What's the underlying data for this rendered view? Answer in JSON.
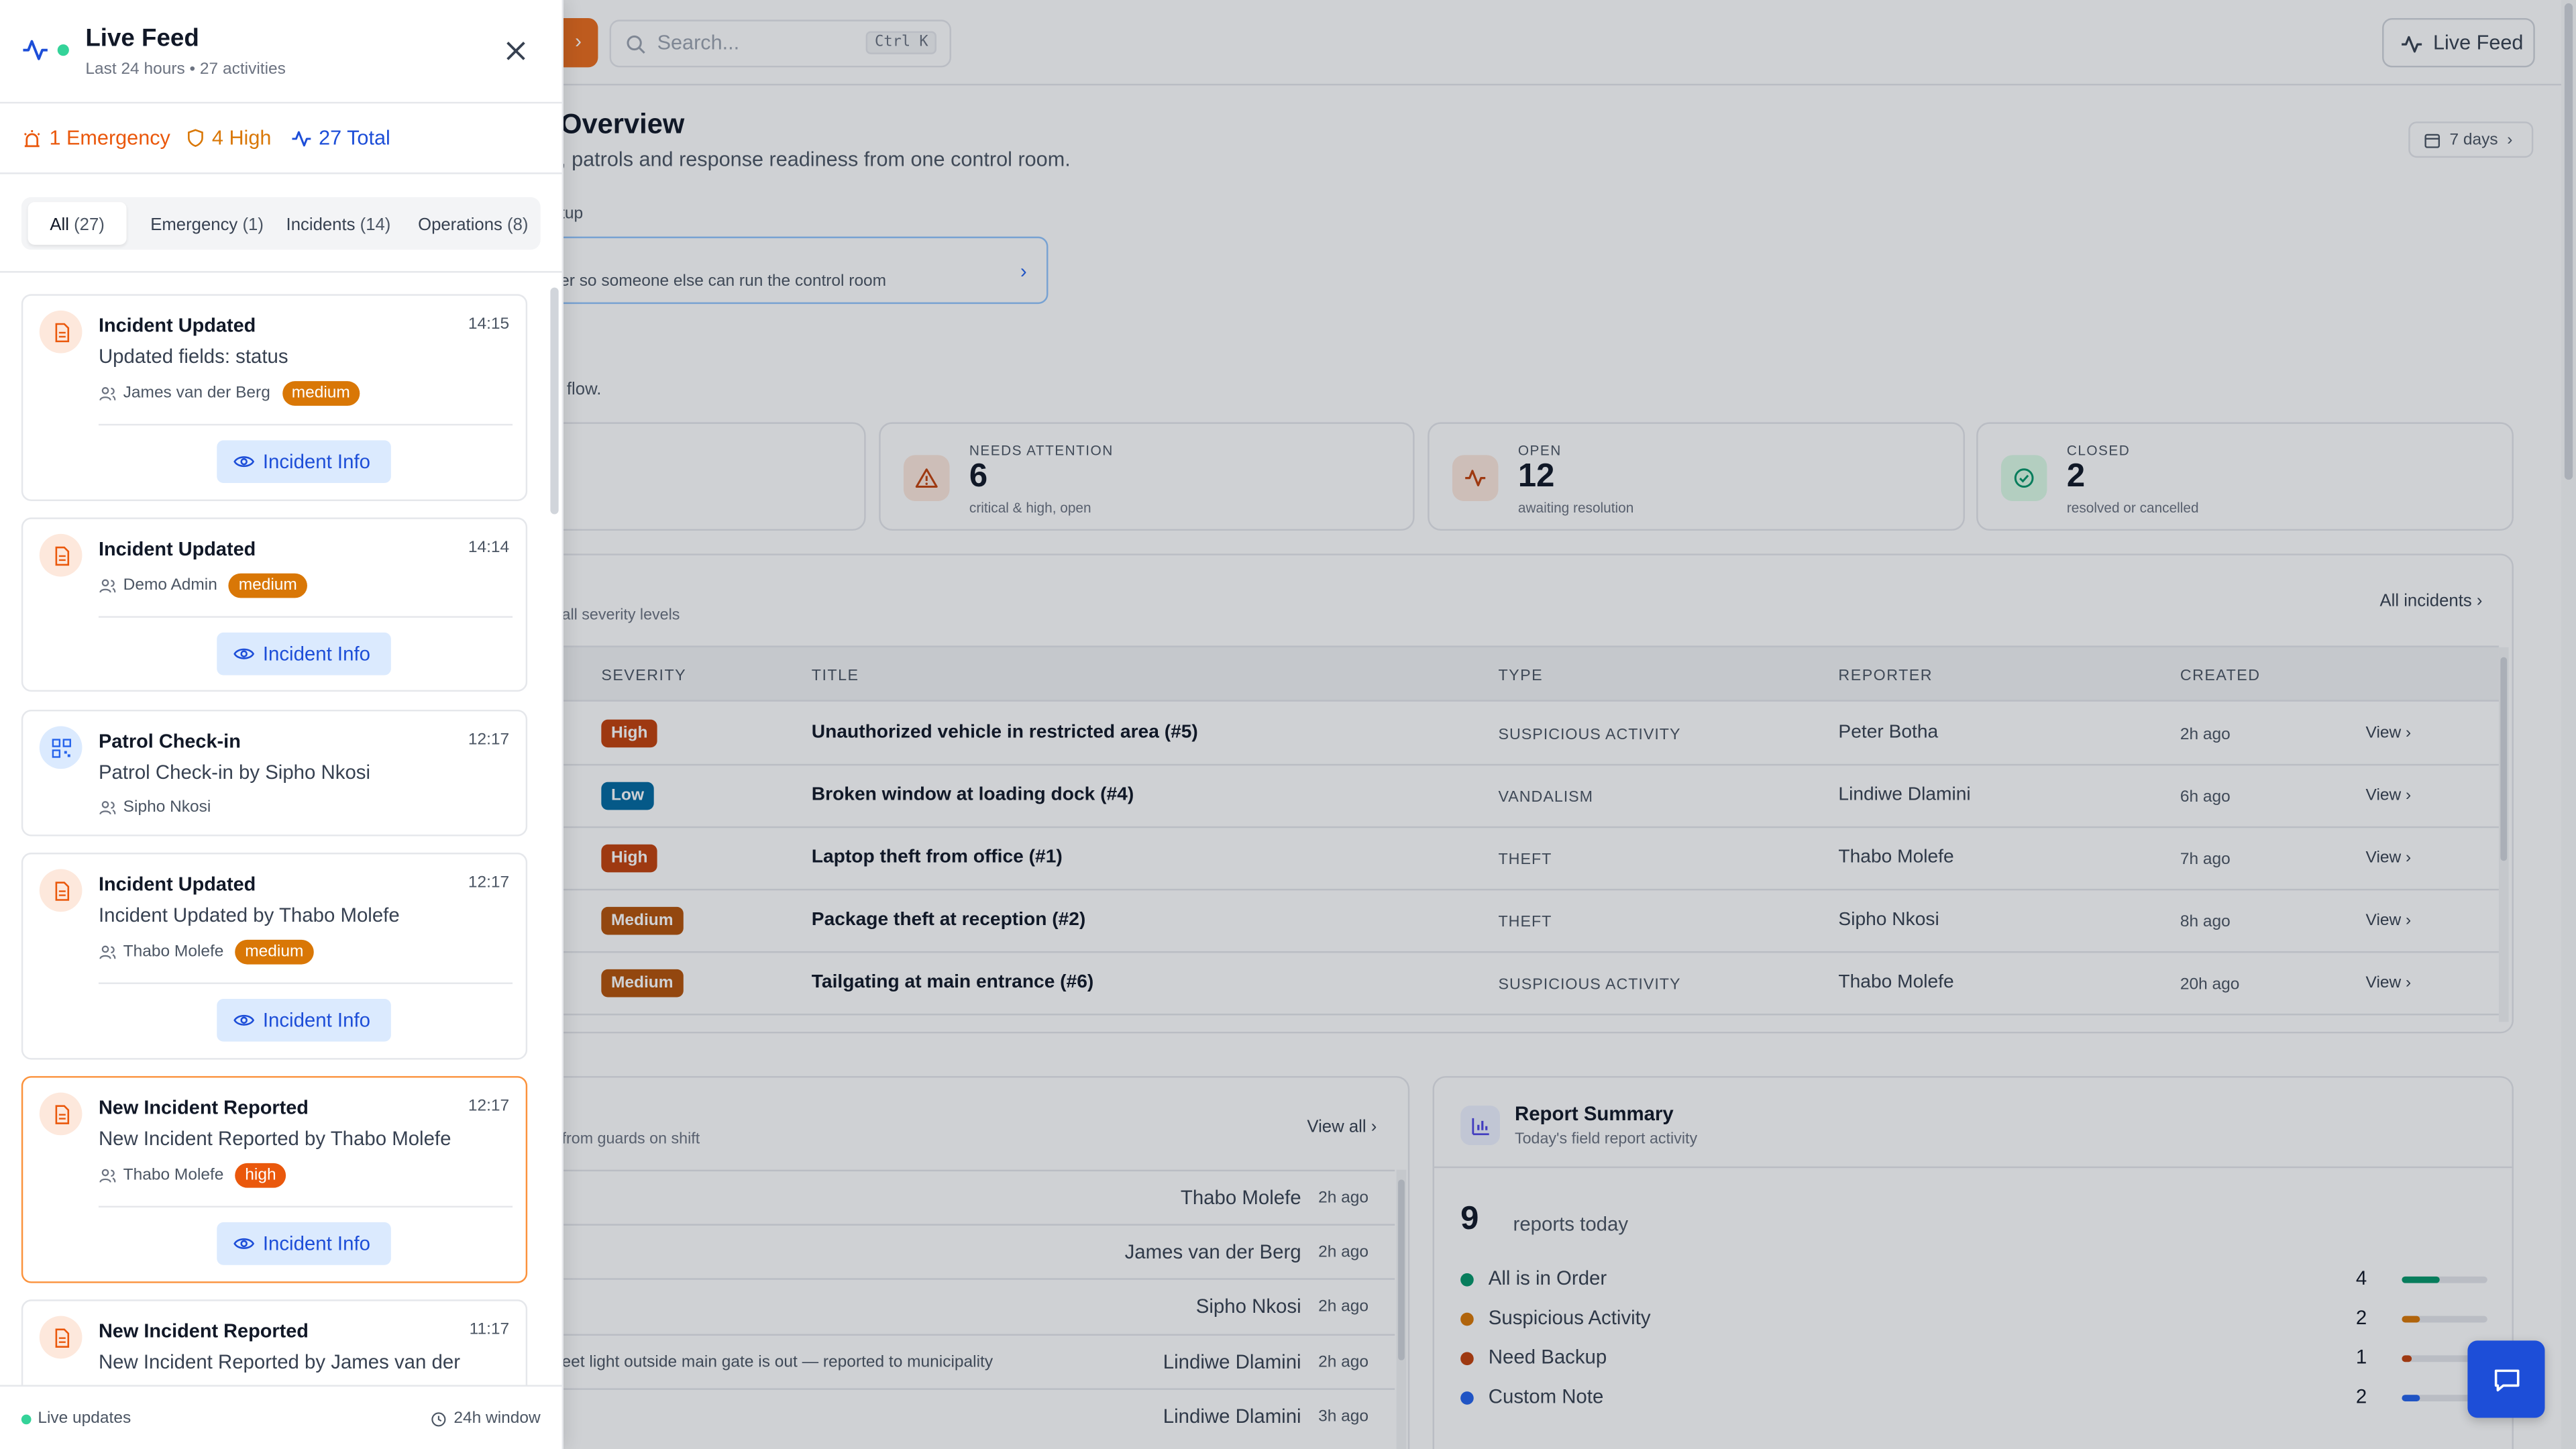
{
  "colors": {
    "accent": "#ea6c1c",
    "primary": "#1d4ed8",
    "high": "#c2410c",
    "high_bright": "#ea580c",
    "medium": "#d97706",
    "low": "#0369a1",
    "green": "#059669",
    "orange": "#f97316"
  },
  "topbar": {
    "menu_chevron": "›",
    "search_placeholder": "Search...",
    "search_shortcut": "Ctrl K",
    "live_feed_button": "Live Feed"
  },
  "header": {
    "title": "Overview",
    "subtitle": ", patrols and response readiness from one control room.",
    "range": "7 days"
  },
  "setup": {
    "label": "tup",
    "text": "er so someone else can run the control room",
    "flow": "flow."
  },
  "stats": [
    {
      "label": "NEEDS ATTENTION",
      "value": "6",
      "caption": "critical & high, open",
      "icon": "warning-icon"
    },
    {
      "label": "OPEN",
      "value": "12",
      "caption": "awaiting resolution",
      "icon": "activity-icon"
    },
    {
      "label": "CLOSED",
      "value": "2",
      "caption": "resolved or cancelled",
      "icon": "check-circle-icon"
    }
  ],
  "incidents": {
    "subtitle": "all severity levels",
    "all_link": "All incidents ›",
    "columns": [
      "SEVERITY",
      "TITLE",
      "TYPE",
      "REPORTER",
      "CREATED"
    ],
    "rows": [
      {
        "severity": "High",
        "title": "Unauthorized vehicle in restricted area (#5)",
        "type": "SUSPICIOUS ACTIVITY",
        "reporter": "Peter Botha",
        "created": "2h ago",
        "view": "View ›"
      },
      {
        "severity": "Low",
        "title": "Broken window at loading dock (#4)",
        "type": "VANDALISM",
        "reporter": "Lindiwe Dlamini",
        "created": "6h ago",
        "view": "View ›"
      },
      {
        "severity": "High",
        "title": "Laptop theft from office (#1)",
        "type": "THEFT",
        "reporter": "Thabo Molefe",
        "created": "7h ago",
        "view": "View ›"
      },
      {
        "severity": "Medium",
        "title": "Package theft at reception (#2)",
        "type": "THEFT",
        "reporter": "Sipho Nkosi",
        "created": "8h ago",
        "view": "View ›"
      },
      {
        "severity": "Medium",
        "title": "Tailgating at main entrance (#6)",
        "type": "SUSPICIOUS ACTIVITY",
        "reporter": "Thabo Molefe",
        "created": "20h ago",
        "view": "View ›"
      }
    ]
  },
  "activity": {
    "subtitle": "from guards on shift",
    "view_all": "View all ›",
    "rows": [
      {
        "note": "",
        "who": "Thabo Molefe",
        "when": "2h ago"
      },
      {
        "note": "",
        "who": "James van der Berg",
        "when": "2h ago"
      },
      {
        "note": "",
        "who": "Sipho Nkosi",
        "when": "2h ago"
      },
      {
        "note": "eet light outside main gate is out — reported to municipality",
        "who": "Lindiwe Dlamini",
        "when": "2h ago"
      },
      {
        "note": "",
        "who": "Lindiwe Dlamini",
        "when": "3h ago"
      }
    ]
  },
  "report_summary": {
    "title": "Report Summary",
    "subtitle": "Today's field report activity",
    "total": "9",
    "total_label": "reports today",
    "items": [
      {
        "label": "All is in Order",
        "count": "4",
        "fraction": 0.44,
        "color": "#059669"
      },
      {
        "label": "Suspicious Activity",
        "count": "2",
        "fraction": 0.22,
        "color": "#d97706"
      },
      {
        "label": "Need Backup",
        "count": "1",
        "fraction": 0.11,
        "color": "#c2410c"
      },
      {
        "label": "Custom Note",
        "count": "2",
        "fraction": 0.22,
        "color": "#2563eb"
      }
    ]
  },
  "drawer": {
    "title": "Live Feed",
    "subtitle": "Last 24 hours • 27 activities",
    "summary": {
      "emergency": "1 Emergency",
      "high": "4 High",
      "total": "27 Total"
    },
    "tabs": [
      {
        "label": "All",
        "count": "(27)"
      },
      {
        "label": "Emergency",
        "count": "(1)"
      },
      {
        "label": "Incidents",
        "count": "(14)"
      },
      {
        "label": "Operations",
        "count": "(8)"
      }
    ],
    "cards": [
      {
        "title": "Incident Updated",
        "time": "14:15",
        "detail": "Updated fields: status",
        "user": "James van der Berg",
        "severity": "medium",
        "button": "Incident Info"
      },
      {
        "title": "Incident Updated",
        "time": "14:14",
        "detail": "",
        "user": "Demo Admin",
        "severity": "medium",
        "button": "Incident Info"
      },
      {
        "title": "Patrol Check-in",
        "time": "12:17",
        "detail": "Patrol Check-in by Sipho Nkosi",
        "user": "Sipho Nkosi",
        "severity": "",
        "button": ""
      },
      {
        "title": "Incident Updated",
        "time": "12:17",
        "detail": "Incident Updated by Thabo Molefe",
        "user": "Thabo Molefe",
        "severity": "medium",
        "button": "Incident Info"
      },
      {
        "title": "New Incident Reported",
        "time": "12:17",
        "detail": "New Incident Reported by Thabo Molefe",
        "user": "Thabo Molefe",
        "severity": "high",
        "button": "Incident Info"
      },
      {
        "title": "New Incident Reported",
        "time": "11:17",
        "detail": "New Incident Reported by James van der",
        "user": "",
        "severity": "",
        "button": ""
      }
    ],
    "footer": {
      "live": "Live updates",
      "window": "24h window"
    }
  },
  "chat": {
    "icon": "chat-icon"
  }
}
